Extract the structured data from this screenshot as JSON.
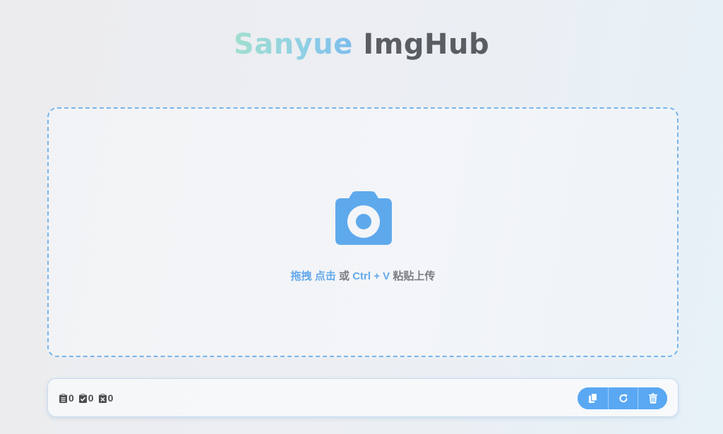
{
  "header": {
    "title_part1": "Sanyue",
    "title_part2": "ImgHub"
  },
  "upload": {
    "hint_drag": "拖拽",
    "hint_click": "点击",
    "hint_or": "或",
    "hint_shortcut": "Ctrl + V",
    "hint_suffix": "粘贴上传",
    "icon": "camera-icon"
  },
  "toolbar": {
    "counts": [
      {
        "icon": "clipboard-list-icon",
        "value": "0"
      },
      {
        "icon": "clipboard-check-icon",
        "value": "0"
      },
      {
        "icon": "clipboard-x-icon",
        "value": "0"
      }
    ],
    "buttons": [
      {
        "icon": "copy-icon"
      },
      {
        "icon": "retry-icon"
      },
      {
        "icon": "trash-icon"
      }
    ]
  },
  "colors": {
    "accent": "#5aa8f3",
    "dashed_border": "#79b4ea",
    "hint_highlight": "#63a9ec",
    "title_dark": "#5a5e63"
  }
}
